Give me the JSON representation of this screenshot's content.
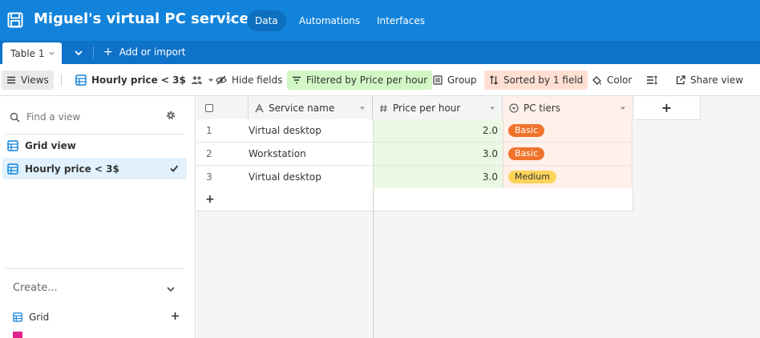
{
  "header": {
    "base_title": "Miguel's virtual PC service",
    "nav_tabs": [
      {
        "label": "Data"
      },
      {
        "label": "Automations"
      },
      {
        "label": "Interfaces"
      }
    ],
    "active_tab": "Data"
  },
  "tab_bar": {
    "table_tab": "Table 1",
    "add_import": "Add or import"
  },
  "toolbar": {
    "views": "Views",
    "current_view": "Hourly price < 3$",
    "hide_fields": "Hide fields",
    "filtered": "Filtered by Price per hour",
    "group": "Group",
    "sorted": "Sorted by 1 field",
    "color": "Color",
    "share_view": "Share view"
  },
  "sidebar": {
    "find_placeholder": "Find a view",
    "views": [
      {
        "label": "Grid view",
        "selected": false
      },
      {
        "label": "Hourly price < 3$",
        "selected": true
      }
    ],
    "create_label": "Create...",
    "create_items": [
      {
        "label": "Grid"
      }
    ]
  },
  "grid": {
    "columns": [
      {
        "label": "Service name",
        "icon": "text-field-icon"
      },
      {
        "label": "Price per hour",
        "icon": "number-field-icon"
      },
      {
        "label": "PC tiers",
        "icon": "single-select-icon"
      }
    ],
    "add_column": "+",
    "rows": [
      {
        "num": "1",
        "service": "Virtual desktop",
        "price": "2.0",
        "tier": "Basic"
      },
      {
        "num": "2",
        "service": "Workstation",
        "price": "3.0",
        "tier": "Basic"
      },
      {
        "num": "3",
        "service": "Virtual desktop",
        "price": "3.0",
        "tier": "Medium"
      }
    ],
    "add_row": "+"
  },
  "colors": {
    "header_bg": "#1283da",
    "tabbar_bg": "#0e72c9",
    "filter_bg": "#d1f7c4",
    "sort_bg": "#ffdfd1",
    "basic_pill": "#f0732c",
    "medium_pill": "#fcd45a"
  }
}
